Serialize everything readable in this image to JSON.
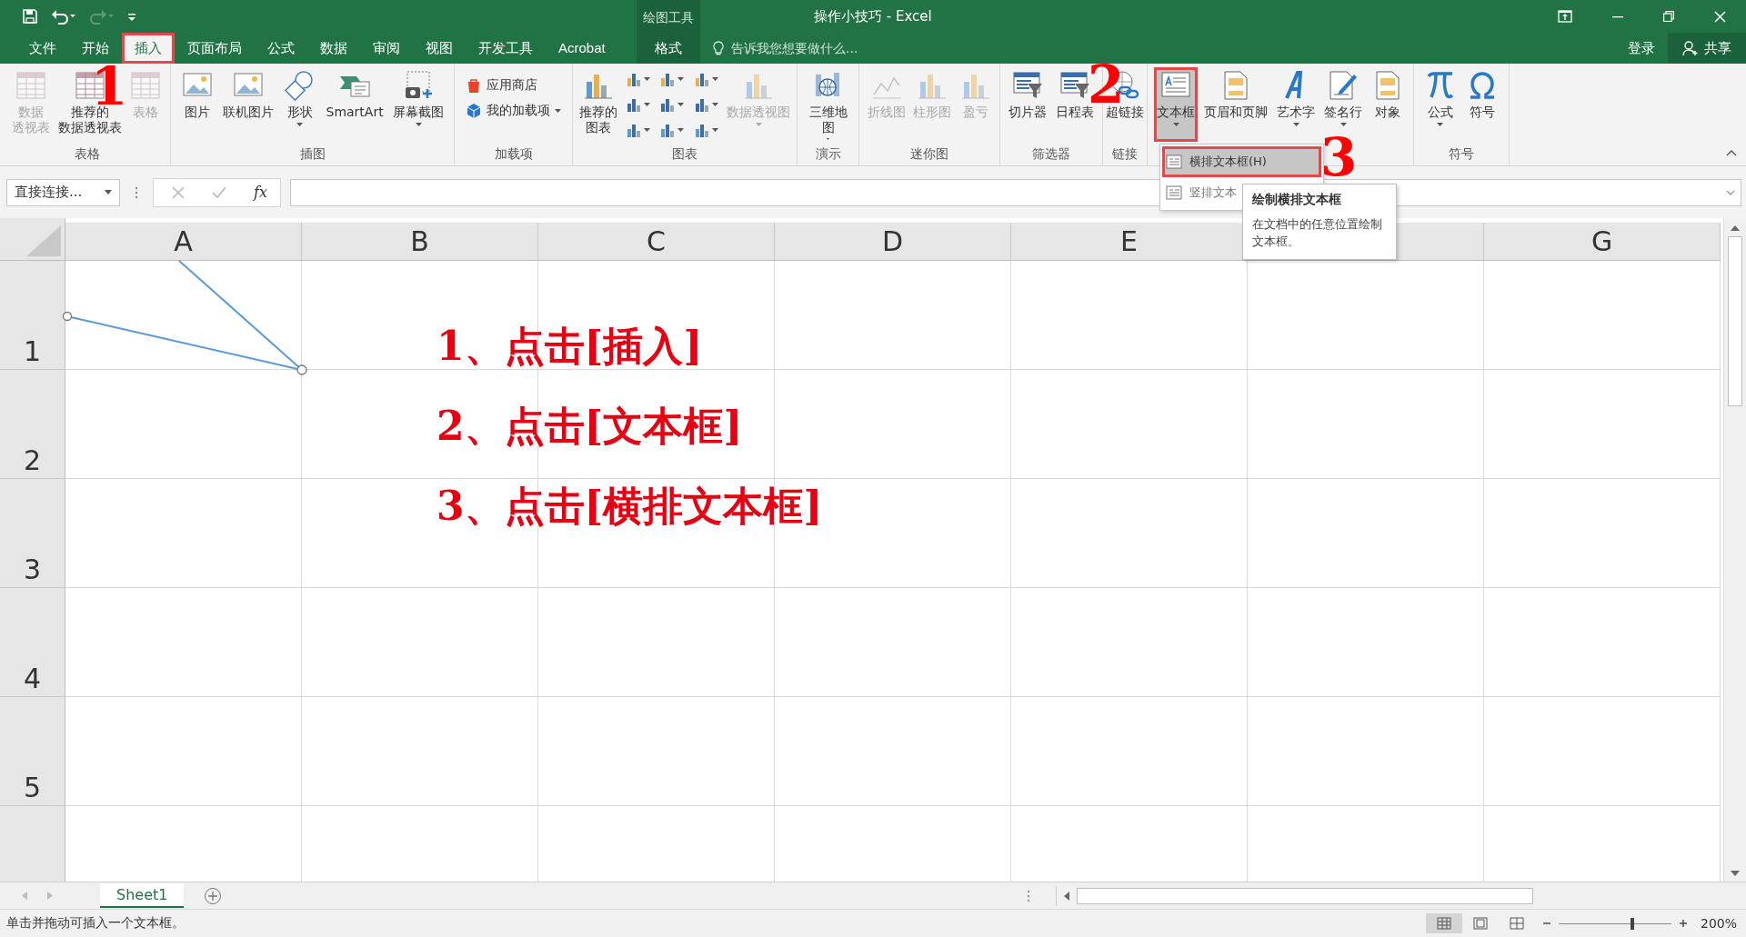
{
  "title_bar": {
    "title": "操作小技巧 - Excel",
    "contextual_group": "绘图工具"
  },
  "quick_access": [
    {
      "kind": "save",
      "disabled": false
    },
    {
      "kind": "undo",
      "disabled": false
    },
    {
      "kind": "redo",
      "disabled": true
    },
    {
      "kind": "customize",
      "disabled": false
    }
  ],
  "tabs": [
    {
      "label": "文件",
      "selected": false,
      "contextual": false
    },
    {
      "label": "开始",
      "selected": false,
      "contextual": false
    },
    {
      "label": "插入",
      "selected": true,
      "contextual": false
    },
    {
      "label": "页面布局",
      "selected": false,
      "contextual": false
    },
    {
      "label": "公式",
      "selected": false,
      "contextual": false
    },
    {
      "label": "数据",
      "selected": false,
      "contextual": false
    },
    {
      "label": "审阅",
      "selected": false,
      "contextual": false
    },
    {
      "label": "视图",
      "selected": false,
      "contextual": false
    },
    {
      "label": "开发工具",
      "selected": false,
      "contextual": false
    },
    {
      "label": "Acrobat",
      "selected": false,
      "contextual": false
    },
    {
      "label": "格式",
      "selected": false,
      "contextual": true
    }
  ],
  "tell_me": {
    "placeholder": "告诉我您想要做什么..."
  },
  "account": {
    "sign_in": "登录",
    "share": "共享"
  },
  "ribbon_groups": [
    {
      "label": "表格",
      "items": [
        {
          "kind": "large",
          "lines": [
            "数据",
            "透视表"
          ],
          "disabled": true,
          "dropdown": false,
          "selected": false
        },
        {
          "kind": "large",
          "lines": [
            "推荐的",
            "数据透视表"
          ],
          "disabled": false,
          "dropdown": false,
          "selected": false
        },
        {
          "kind": "large",
          "label": "表格",
          "disabled": true,
          "dropdown": false,
          "selected": false
        }
      ]
    },
    {
      "label": "插图",
      "items": [
        {
          "kind": "large",
          "label": "图片",
          "disabled": false,
          "dropdown": false,
          "selected": false
        },
        {
          "kind": "large",
          "label": "联机图片",
          "disabled": false,
          "dropdown": false,
          "selected": false
        },
        {
          "kind": "large",
          "label": "形状",
          "disabled": false,
          "dropdown": true,
          "selected": false
        },
        {
          "kind": "large",
          "label": "SmartArt",
          "disabled": false,
          "dropdown": false,
          "selected": false
        },
        {
          "kind": "large",
          "label": "屏幕截图",
          "disabled": false,
          "dropdown": true,
          "selected": false
        }
      ]
    },
    {
      "label": "加载项",
      "items": [
        {
          "kind": "small",
          "label": "应用商店",
          "disabled": false,
          "dropdown": false,
          "selected": false
        },
        {
          "kind": "small",
          "label": "我的加载项",
          "disabled": false,
          "dropdown": true,
          "selected": false
        }
      ]
    },
    {
      "label": "图表",
      "items": [
        {
          "kind": "large",
          "lines": [
            "推荐的",
            "图表"
          ],
          "disabled": false,
          "dropdown": false,
          "selected": false
        },
        {
          "kind": "icon",
          "disabled": false,
          "dropdown": true,
          "selected": false
        },
        {
          "kind": "icon",
          "disabled": false,
          "dropdown": true,
          "selected": false
        },
        {
          "kind": "icon",
          "disabled": false,
          "dropdown": true,
          "selected": false
        },
        {
          "kind": "icon",
          "disabled": false,
          "dropdown": true,
          "selected": false
        },
        {
          "kind": "icon",
          "disabled": false,
          "dropdown": true,
          "selected": false
        },
        {
          "kind": "icon",
          "disabled": false,
          "dropdown": true,
          "selected": false
        },
        {
          "kind": "icon",
          "disabled": false,
          "dropdown": true,
          "selected": false
        },
        {
          "kind": "icon",
          "disabled": false,
          "dropdown": true,
          "selected": false
        },
        {
          "kind": "icon",
          "disabled": false,
          "dropdown": true,
          "selected": false
        },
        {
          "kind": "large",
          "label": "数据透视图",
          "disabled": true,
          "dropdown": true,
          "selected": false
        }
      ]
    },
    {
      "label": "演示",
      "items": [
        {
          "kind": "large",
          "lines": [
            "三维地",
            "图"
          ],
          "disabled": false,
          "dropdown": true,
          "selected": false
        }
      ]
    },
    {
      "label": "迷你图",
      "items": [
        {
          "kind": "large",
          "label": "折线图",
          "disabled": true,
          "dropdown": false,
          "selected": false
        },
        {
          "kind": "large",
          "label": "柱形图",
          "disabled": true,
          "dropdown": false,
          "selected": false
        },
        {
          "kind": "large",
          "label": "盈亏",
          "disabled": true,
          "dropdown": false,
          "selected": false
        }
      ]
    },
    {
      "label": "筛选器",
      "items": [
        {
          "kind": "large",
          "label": "切片器",
          "disabled": false,
          "dropdown": false,
          "selected": false
        },
        {
          "kind": "large",
          "label": "日程表",
          "disabled": false,
          "dropdown": false,
          "selected": false
        }
      ]
    },
    {
      "label": "链接",
      "items": [
        {
          "kind": "large",
          "label": "超链接",
          "disabled": false,
          "dropdown": false,
          "selected": false
        }
      ]
    },
    {
      "items": [
        {
          "kind": "large",
          "label": "文本框",
          "disabled": false,
          "dropdown": true,
          "selected": true
        },
        {
          "kind": "large",
          "label": "页眉和页脚",
          "disabled": false,
          "dropdown": false,
          "selected": false
        },
        {
          "kind": "large",
          "label": "艺术字",
          "disabled": false,
          "dropdown": true,
          "selected": false
        },
        {
          "kind": "large",
          "label": "签名行",
          "disabled": false,
          "dropdown": true,
          "selected": false
        },
        {
          "kind": "large",
          "label": "对象",
          "disabled": false,
          "dropdown": false,
          "selected": false
        }
      ]
    },
    {
      "label": "符号",
      "items": [
        {
          "kind": "large",
          "label": "公式",
          "disabled": false,
          "dropdown": true,
          "selected": false
        },
        {
          "kind": "large",
          "label": "符号",
          "disabled": false,
          "dropdown": false,
          "selected": false
        }
      ]
    }
  ],
  "dropdown_menu": {
    "items": [
      {
        "label": "横排文本框(H)",
        "selected": true
      },
      {
        "label": "竖排文本",
        "selected": false
      }
    ]
  },
  "tooltip": {
    "title": "绘制横排文本框",
    "body": "在文档中的任意位置绘制文本框。"
  },
  "formula_bar": {
    "name_box": "直接连接...",
    "function_label": "fx"
  },
  "sheet": {
    "columns": [
      {
        "label": "A"
      },
      {
        "label": "B"
      },
      {
        "label": "C"
      },
      {
        "label": "D"
      },
      {
        "label": "E"
      },
      {},
      {
        "label": "G"
      }
    ],
    "rows": [
      "1",
      "2",
      "3",
      "4",
      "5"
    ]
  },
  "instructions": [
    "1、点击[插入]",
    "2、点击[文本框]",
    "3、点击[横排文本框]"
  ],
  "annotations": [
    "1",
    "2",
    "3"
  ],
  "sheet_tabs": [
    {
      "label": "Sheet1",
      "selected": true
    }
  ],
  "status_bar": {
    "message": "单击并拖动可插入一个文本框。",
    "views": [
      {
        "kind": "normal",
        "selected": true
      },
      {
        "kind": "page_layout",
        "selected": false
      },
      {
        "kind": "page_break",
        "selected": false
      }
    ],
    "zoom": {
      "level": 0.65,
      "reading": "200%"
    }
  }
}
